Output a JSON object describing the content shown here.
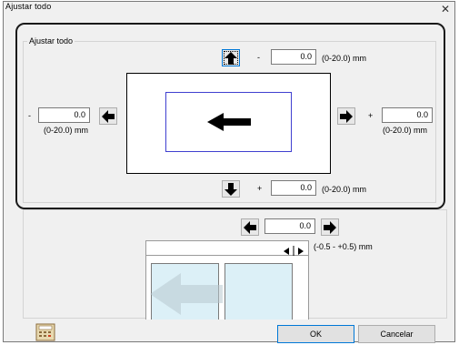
{
  "dialog": {
    "title": "Ajustar todo",
    "group_label": "Ajustar todo"
  },
  "top": {
    "sign": "-",
    "value": "0.0",
    "range": "(0-20.0) mm"
  },
  "left": {
    "sign": "-",
    "value": "0.0",
    "range": "(0-20.0) mm"
  },
  "right": {
    "sign": "+",
    "value": "0.0",
    "range": "(0-20.0) mm"
  },
  "bottom": {
    "sign": "+",
    "value": "0.0",
    "range": "(0-20.0) mm"
  },
  "gap": {
    "value": "0.0",
    "sign_minus": "-",
    "sign_plus": "+",
    "range": "(-0.5 - +0.5) mm"
  },
  "buttons": {
    "ok": "OK",
    "cancel": "Cancelar"
  },
  "icons": {
    "up": "arrow-up-icon",
    "down": "arrow-down-icon",
    "left": "arrow-left-icon",
    "right": "arrow-right-icon",
    "calculator": "calculator-icon",
    "close": "close-icon"
  },
  "colors": {
    "highlight_border": "#1a1a1a",
    "inner_rect": "#4040d0",
    "panel_fill": "#dcf0f7",
    "focus_border": "#0078d7"
  }
}
